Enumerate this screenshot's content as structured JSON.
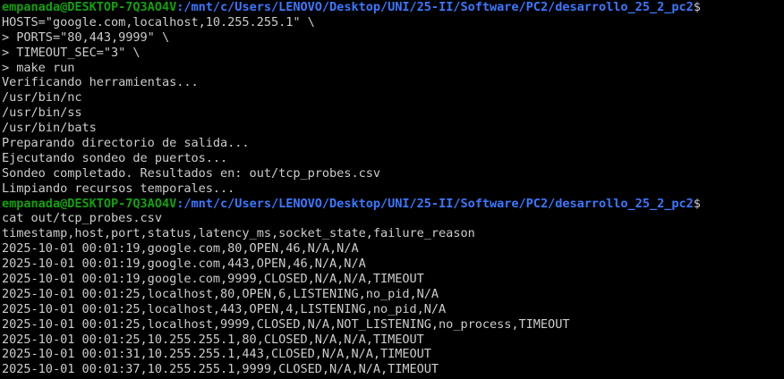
{
  "window": {
    "colors": {
      "background": "#000000",
      "text": "#cccccc",
      "user_host": "#13a10e",
      "path": "#3b78ff"
    }
  },
  "prompt1": {
    "user_host": "empanada@DESKTOP-7Q3AO4V",
    "path": ":/mnt/c/Users/LENOVO/Desktop/UNI/25-II/Software/PC2/desarrollo_25_2_pc2",
    "symbol": "$"
  },
  "block1": [
    "HOSTS=\"google.com,localhost,10.255.255.1\" \\",
    "> PORTS=\"80,443,9999\" \\",
    "> TIMEOUT_SEC=\"3\" \\",
    "> make run",
    "Verificando herramientas...",
    "/usr/bin/nc",
    "/usr/bin/ss",
    "/usr/bin/bats",
    "Preparando directorio de salida...",
    "Ejecutando sondeo de puertos...",
    "Sondeo completado. Resultados en: out/tcp_probes.csv",
    "Limpiando recursos temporales..."
  ],
  "prompt2": {
    "user_host": "empanada@DESKTOP-7Q3AO4V",
    "path": ":/mnt/c/Users/LENOVO/Desktop/UNI/25-II/Software/PC2/desarrollo_25_2_pc2",
    "symbol": "$"
  },
  "block2": [
    "cat out/tcp_probes.csv",
    "timestamp,host,port,status,latency_ms,socket_state,failure_reason",
    "2025-10-01 00:01:19,google.com,80,OPEN,46,N/A,N/A",
    "2025-10-01 00:01:19,google.com,443,OPEN,46,N/A,N/A",
    "2025-10-01 00:01:19,google.com,9999,CLOSED,N/A,N/A,TIMEOUT",
    "2025-10-01 00:01:25,localhost,80,OPEN,6,LISTENING,no_pid,N/A",
    "2025-10-01 00:01:25,localhost,443,OPEN,4,LISTENING,no_pid,N/A",
    "2025-10-01 00:01:25,localhost,9999,CLOSED,N/A,NOT_LISTENING,no_process,TIMEOUT",
    "2025-10-01 00:01:25,10.255.255.1,80,CLOSED,N/A,N/A,TIMEOUT",
    "2025-10-01 00:01:31,10.255.255.1,443,CLOSED,N/A,N/A,TIMEOUT",
    "2025-10-01 00:01:37,10.255.255.1,9999,CLOSED,N/A,N/A,TIMEOUT"
  ]
}
